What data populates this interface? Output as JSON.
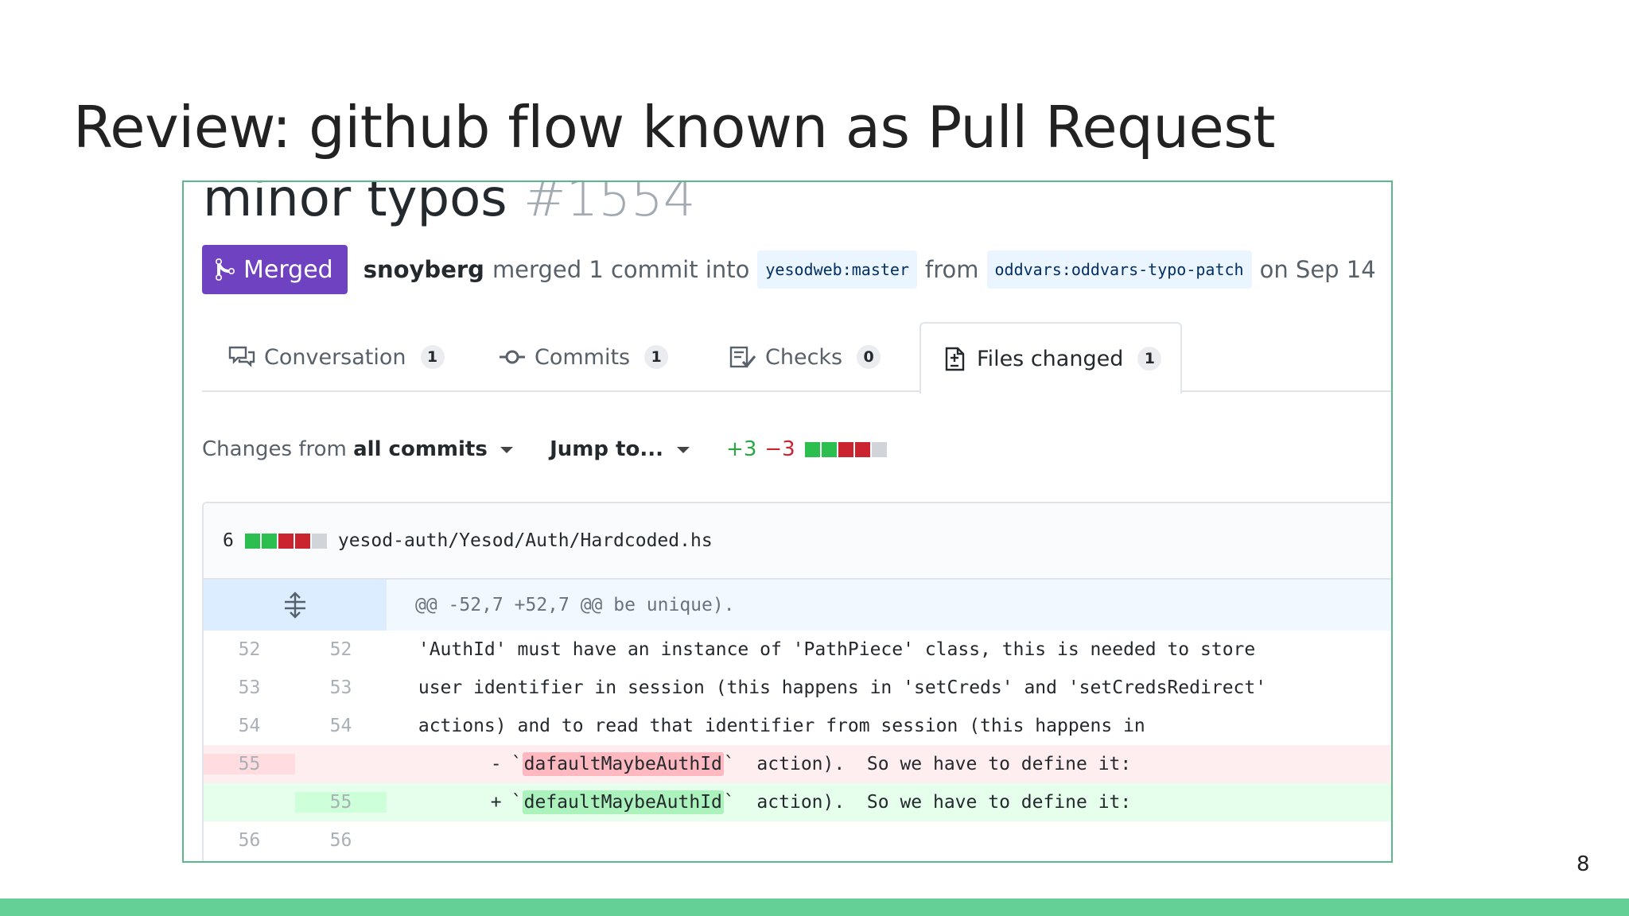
{
  "slide": {
    "title": "Review: github flow known as Pull Request",
    "page_number": "8"
  },
  "pr": {
    "title": "minor typos",
    "number": "#1554",
    "status": "Merged",
    "user": "snoyberg",
    "merged_text": "merged 1 commit into",
    "base_branch": "yesodweb:master",
    "from_text": "from",
    "head_branch": "oddvars:oddvars-typo-patch",
    "date_text": "on Sep 14"
  },
  "tabs": [
    {
      "label": "Conversation",
      "count": "1",
      "icon": "comment-discussion-icon"
    },
    {
      "label": "Commits",
      "count": "1",
      "icon": "git-commit-icon"
    },
    {
      "label": "Checks",
      "count": "0",
      "icon": "checklist-icon"
    },
    {
      "label": "Files changed",
      "count": "1",
      "icon": "file-diff-icon",
      "active": true
    }
  ],
  "toolbar": {
    "changes_prefix": "Changes from",
    "changes_value": "all commits",
    "jump_label": "Jump to...",
    "additions": "+3",
    "deletions": "−3"
  },
  "file": {
    "changes": "6",
    "path": "yesod-auth/Yesod/Auth/Hardcoded.hs",
    "hunk_header": "@@ -52,7 +52,7 @@ be unique).",
    "lines": [
      {
        "old": "52",
        "new": "52",
        "text": " 'AuthId' must have an instance of 'PathPiece' class, this is needed to store"
      },
      {
        "old": "53",
        "new": "53",
        "text": " user identifier in session (this happens in 'setCreds' and 'setCredsRedirect'"
      },
      {
        "old": "54",
        "new": "54",
        "text": " actions) and to read that identifier from session (this happens in"
      }
    ],
    "deleted": {
      "old": "55",
      "marker": "-",
      "tick_open": "`",
      "word": "dafaultMaybeAuthId",
      "rest": "`  action).  So we have to define it:"
    },
    "added": {
      "new": "55",
      "marker": "+",
      "tick_open": "`",
      "word": "defaultMaybeAuthId",
      "rest": "`  action).  So we have to define it:"
    },
    "last": {
      "old": "56",
      "new": "56"
    }
  },
  "colors": {
    "merged": "#6f42c1",
    "addition": "#28a745",
    "deletion": "#cb2431",
    "accent_bar": "#65d096"
  }
}
